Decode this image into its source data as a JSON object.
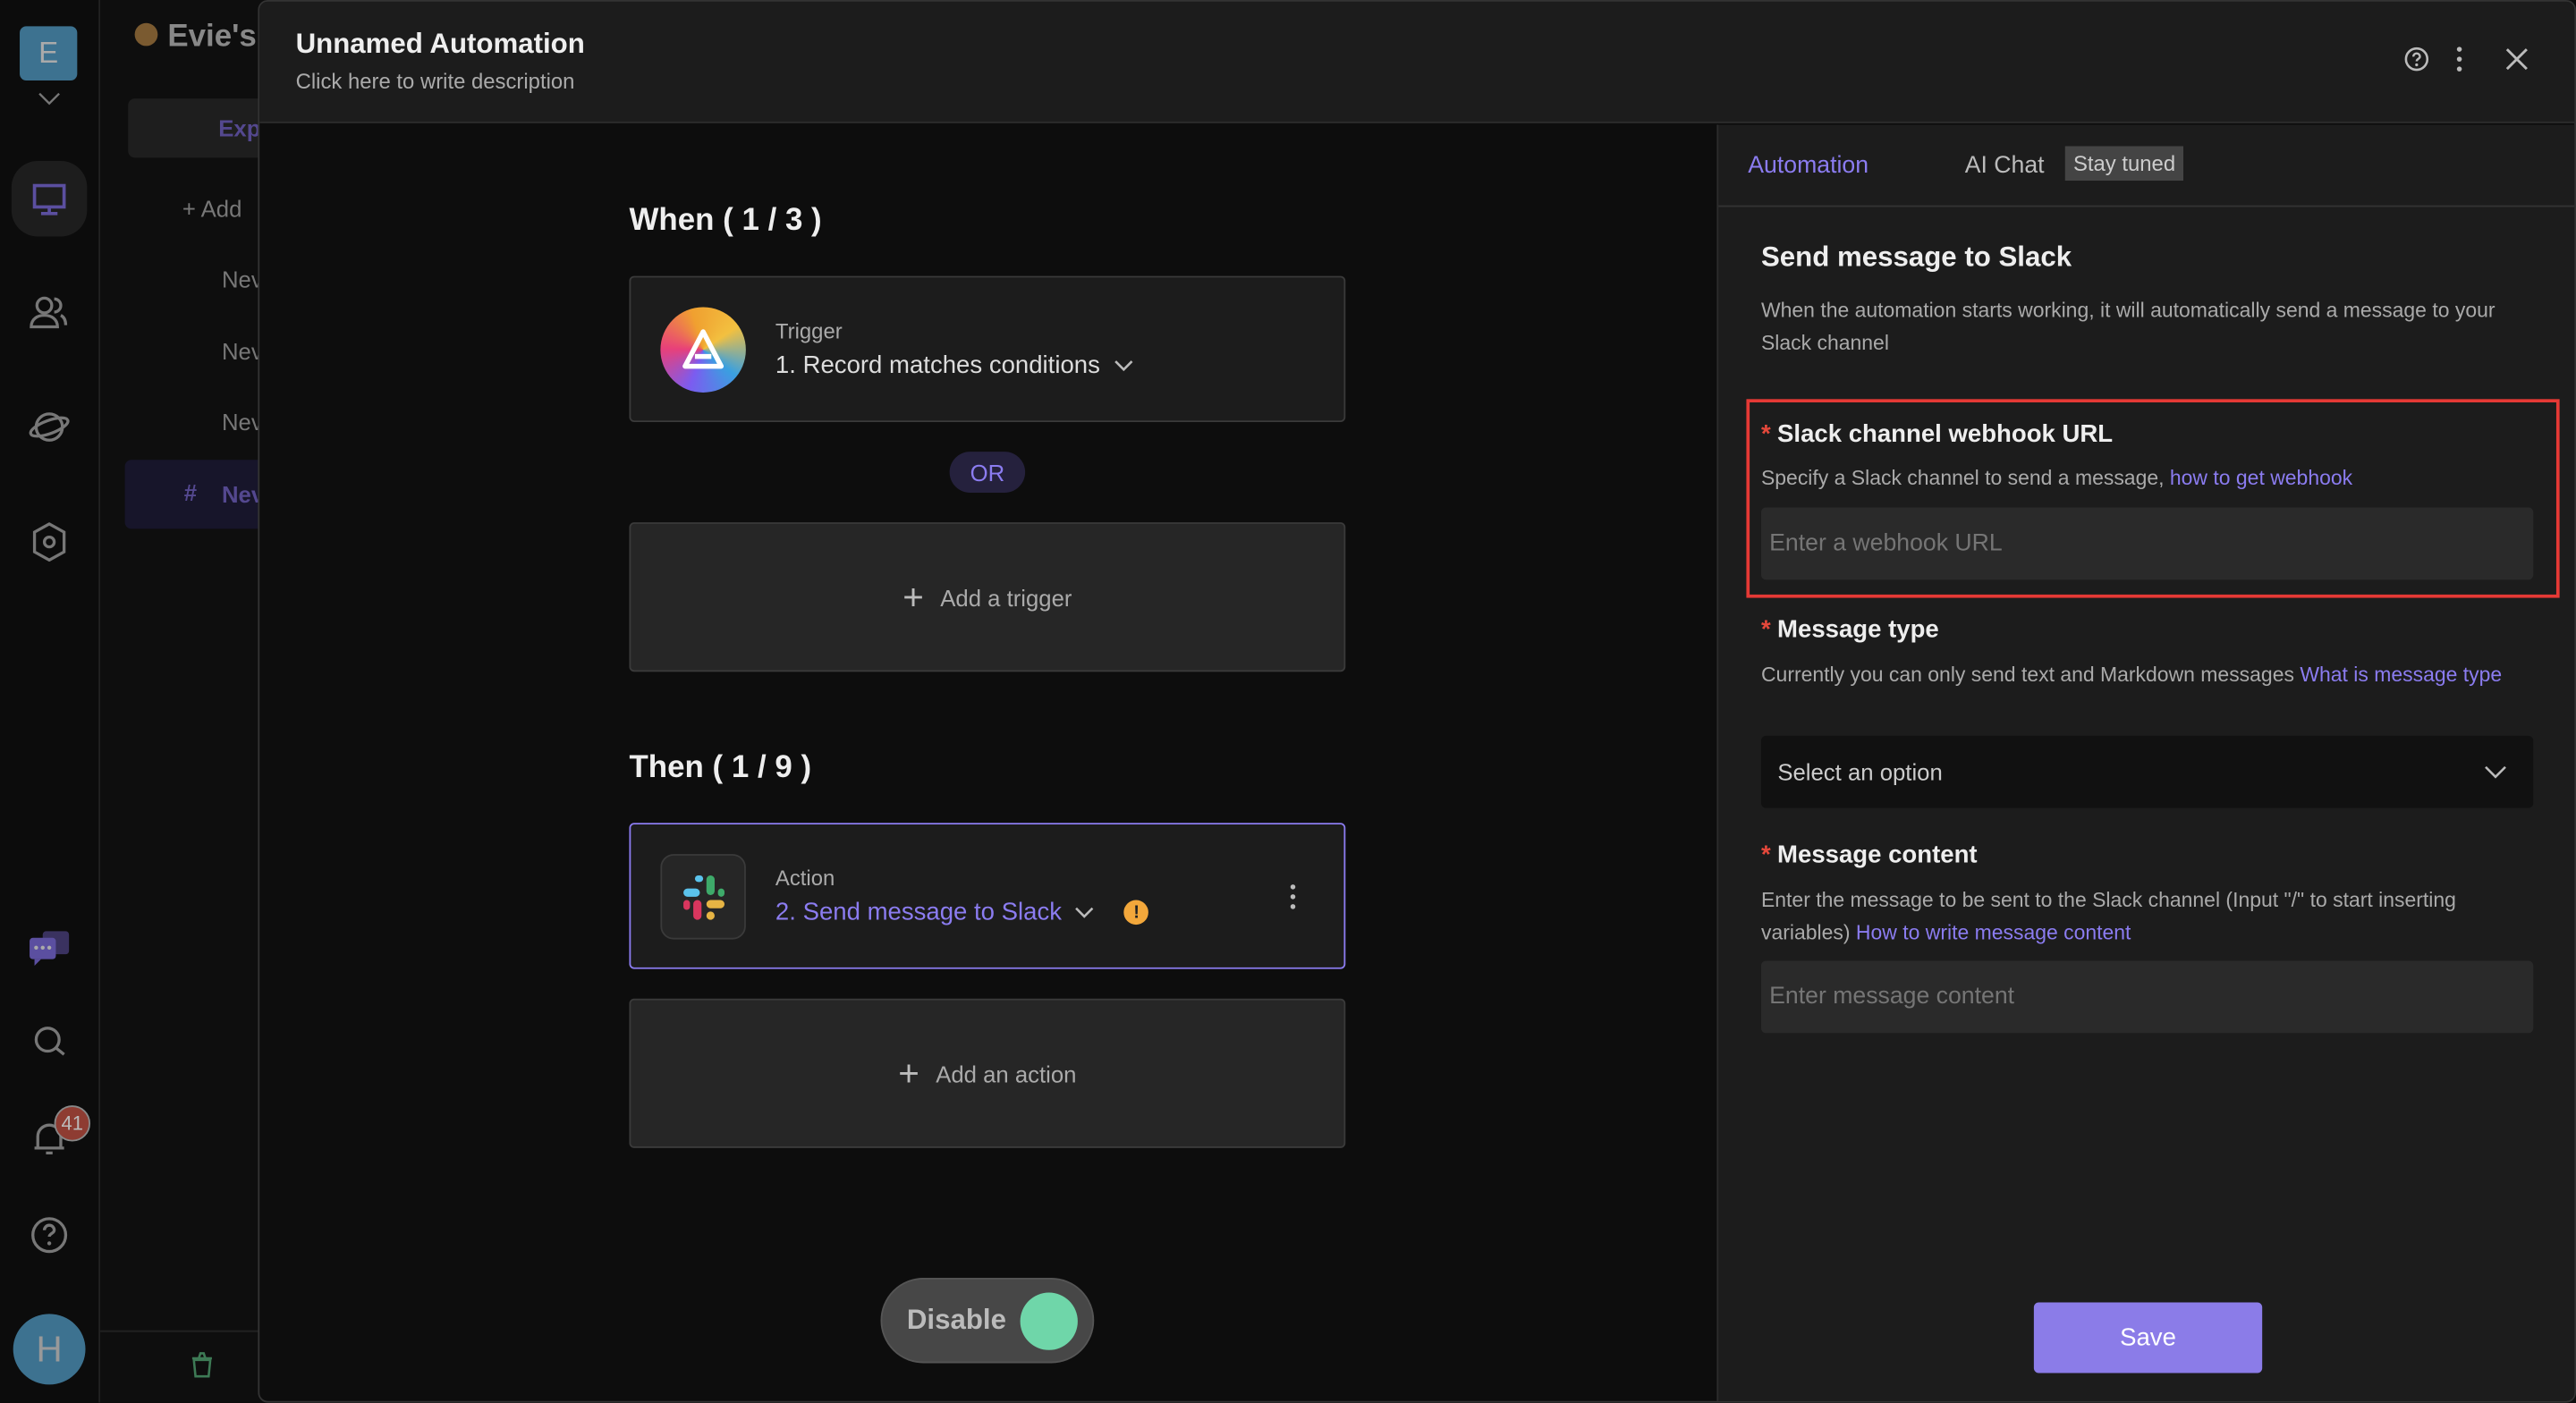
{
  "rail": {
    "workspace_initial": "E",
    "notification_count": "41",
    "user_initial": "H"
  },
  "sidebar": {
    "title": "Evie's",
    "explore_label": "Exp",
    "add_label": "Add",
    "items": [
      "Nev",
      "Nev",
      "Nev",
      "Nev"
    ]
  },
  "header": {
    "title": "Unnamed Automation",
    "description": "Click here to write description"
  },
  "canvas": {
    "when_heading": "When ( 1 / 3 )",
    "trigger_label": "Trigger",
    "trigger_value": "1. Record matches conditions",
    "or_label": "OR",
    "add_trigger": "Add a trigger",
    "then_heading": "Then ( 1 / 9 )",
    "action_label": "Action",
    "action_value": "2. Send message to Slack",
    "add_action": "Add an action",
    "toggle_label": "Disable",
    "toggle_on": true
  },
  "panel": {
    "tabs": [
      {
        "label": "Automation",
        "active": true
      },
      {
        "label": "AI Chat",
        "badge": "Stay tuned"
      }
    ],
    "title": "Send message to Slack",
    "description": "When the automation starts working, it will automatically send a message to your Slack channel",
    "fields": [
      {
        "label": "Slack channel webhook URL",
        "help": "Specify a Slack channel to send a message, ",
        "link": "how to get webhook",
        "placeholder": "Enter a webhook URL"
      },
      {
        "label": "Message type",
        "help": "Currently you can only send text and Markdown messages ",
        "link": "What is message type",
        "placeholder": "Select an option"
      },
      {
        "label": "Message content",
        "help": "Enter the message to be sent to the Slack channel (Input \"/\" to start inserting variables) ",
        "link": "How to write message content",
        "placeholder": "Enter message content"
      }
    ],
    "save_label": "Save"
  },
  "colors": {
    "accent": "#8b7cf0",
    "highlight": "#e53935",
    "toggle": "#6fd6a9",
    "warning": "#f2a73b"
  }
}
